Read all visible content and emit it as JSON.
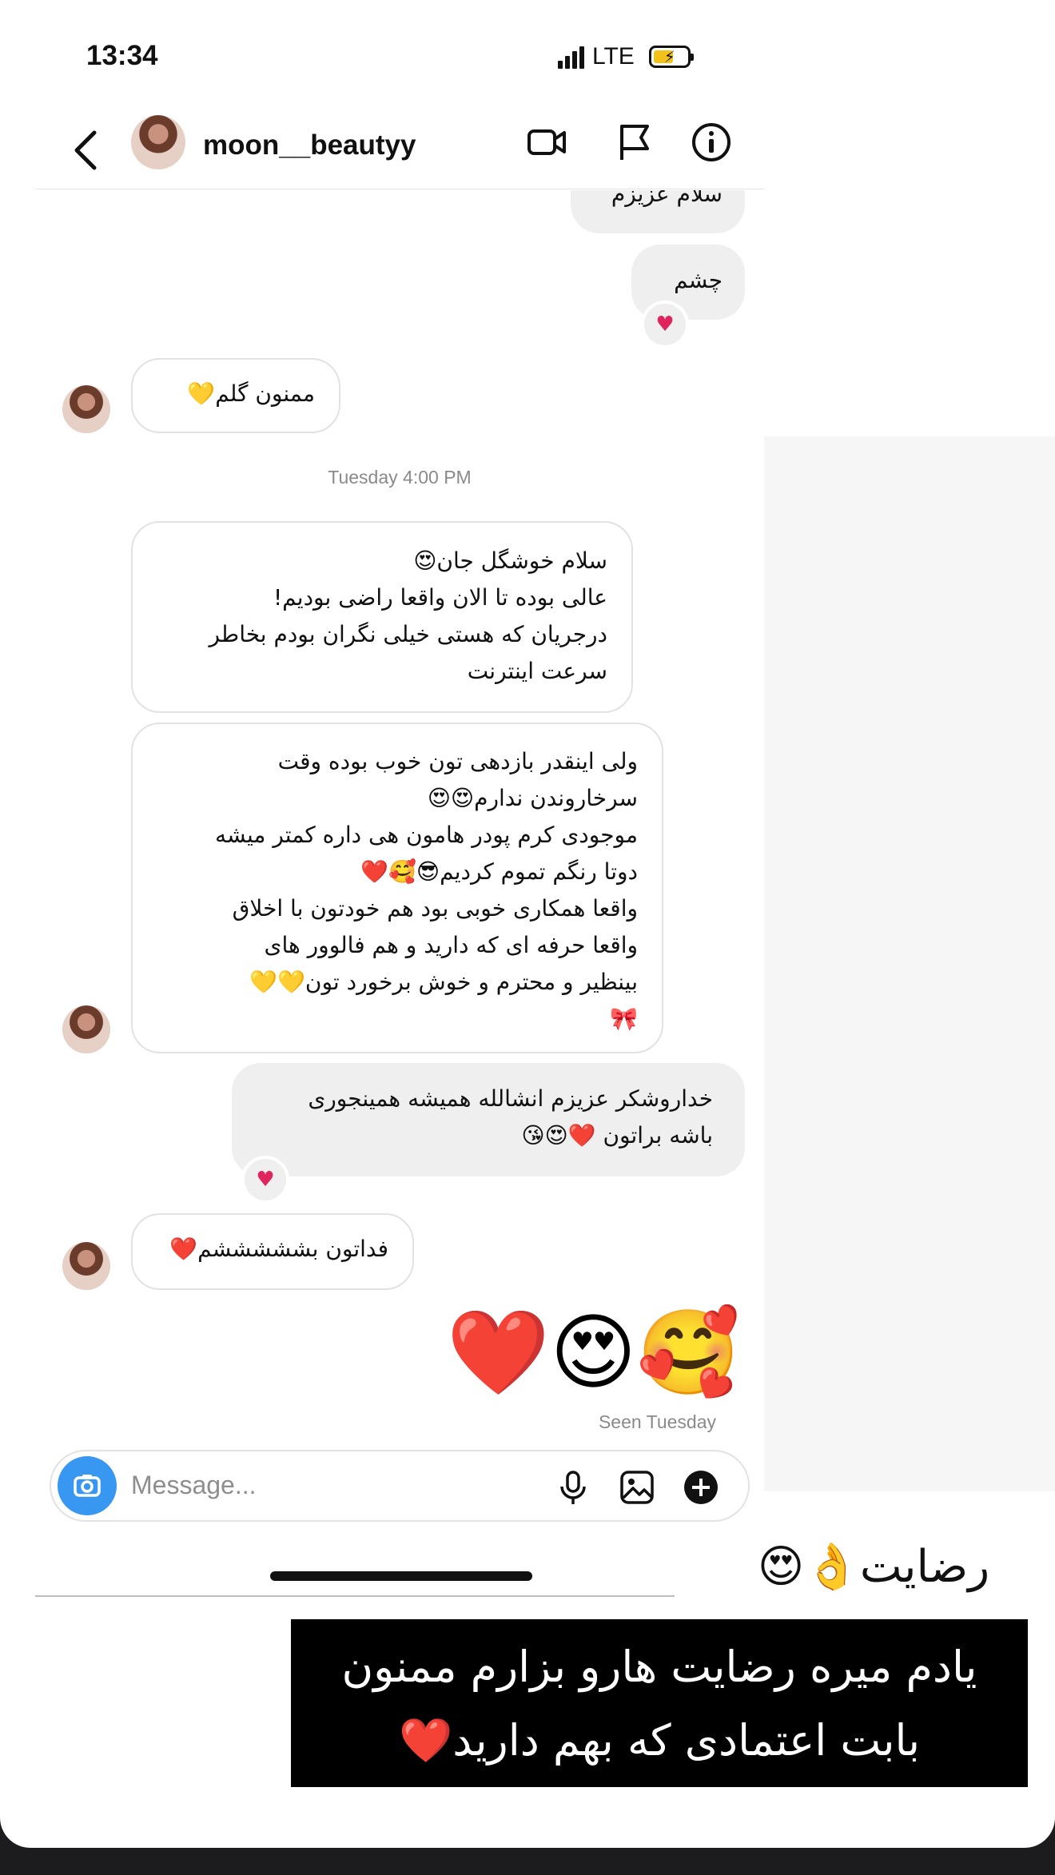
{
  "status_bar": {
    "time": "13:34",
    "network": "LTE"
  },
  "header": {
    "username": "moon__beautyy",
    "icons": [
      "back-chevron-icon",
      "video-call-icon",
      "flag-icon",
      "info-icon"
    ]
  },
  "messages": {
    "out_1": "سلام عزیزم",
    "out_2": "چشم",
    "out_2_reaction": "♥",
    "in_1": "ممنون گلم💛",
    "timestamp": "Tuesday 4:00 PM",
    "in_2": [
      "سلام خوشگل جان😍",
      "عالی بوده تا الان واقعا راضی بودیم!",
      "درجریان که هستی خیلی نگران بودم بخاطر",
      "سرعت اینترنت"
    ],
    "in_3": [
      "ولی اینقدر بازدهی تون خوب بوده وقت",
      "سرخاروندن ندارم😍😍",
      "موجودی کرم پودر هامون هی داره کمتر میشه",
      "دوتا رنگم تموم کردیم😎🥰❤️",
      "واقعا همکاری خوبی بود هم خودتون با اخلاق",
      "واقعا حرفه ای که دارید و هم فالوور های",
      "بینظیر و محترم و خوش برخورد تون💛💛",
      "🎀"
    ],
    "out_3": [
      "خداروشکر عزیزم انشالله همیشه همینجوری",
      "باشه براتون ❤️😍😘"
    ],
    "out_3_reaction": "♥",
    "in_4": "فداتون بشششششم❤️",
    "emoji_reply": "❤️😍🥰",
    "seen": "Seen Tuesday"
  },
  "composer": {
    "placeholder": "Message..."
  },
  "captions": {
    "satisfaction": "رضایت👌😍",
    "note_line1": "یادم میره رضایت هارو بزارم ممنون",
    "note_line2": "بابت اعتمادی که بهم دارید❤️"
  }
}
